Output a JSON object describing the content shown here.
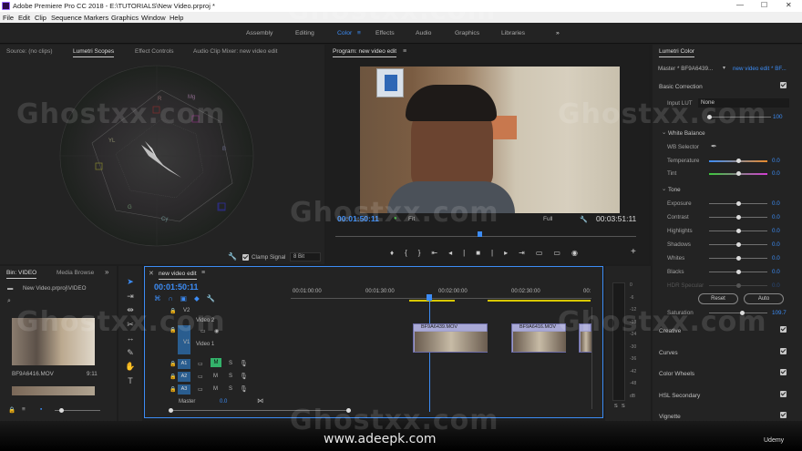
{
  "window": {
    "title": "Adobe Premiere Pro CC 2018 - E:\\TUTORIALS\\New Video.prproj *",
    "min": "—",
    "max": "☐",
    "close": "✕"
  },
  "menu": [
    "File",
    "Edit",
    "Clip",
    "Sequence",
    "Markers",
    "Graphics",
    "Window",
    "Help"
  ],
  "workspaces": [
    "Assembly",
    "Editing",
    "Color",
    "Effects",
    "Audio",
    "Graphics",
    "Libraries"
  ],
  "workspace_active": "Color",
  "workspace_more": "»",
  "source_panel": {
    "tabs": [
      "Source: (no clips)",
      "Lumetri Scopes",
      "Effect Controls",
      "Audio Clip Mixer: new video edit"
    ],
    "active": "Lumetri Scopes",
    "scope_labels": {
      "R": "R",
      "Mg": "Mg",
      "YL": "YL",
      "B": "B",
      "G": "G",
      "Cy": "Cy"
    },
    "clamp_signal": "Clamp Signal",
    "bit_depth": "8 Bit"
  },
  "program": {
    "title": "Program: new video edit",
    "timecode_in": "00:01:50:11",
    "fit": "Fit",
    "quality": "Full",
    "duration": "00:03:51:11"
  },
  "project": {
    "tabs": [
      "Bin: VIDEO",
      "Media Browse"
    ],
    "more": "»",
    "path": "New Video.prproj\\VIDEO",
    "clip_name": "BF9A6416.MOV",
    "clip_duration": "9:11"
  },
  "timeline": {
    "tab": "new video edit",
    "timecode": "00:01:50:11",
    "ruler": [
      "00:01:00:00",
      "00:01:30:00",
      "00:02:00:00",
      "00:02:30:00",
      "00:"
    ],
    "tracks": {
      "v2": "V2",
      "video2": "Video 2",
      "v1": "V1",
      "video1": "Video 1",
      "a1": "A1",
      "a2": "A2",
      "a3": "A3",
      "master": "Master",
      "master_val": "0.0"
    },
    "clips": [
      {
        "label": "BF9A6439.MOV"
      },
      {
        "label": "BF9A6416.MOV"
      }
    ],
    "m": "M",
    "s": "S"
  },
  "meter": {
    "labels": [
      "0",
      "-6",
      "-12",
      "-18",
      "-24",
      "-30",
      "-36",
      "-42",
      "-48",
      "dB"
    ],
    "solo": [
      "S",
      "S"
    ]
  },
  "lumetri": {
    "title": "Lumetri Color",
    "master": "Master * BF9A6439...",
    "sequence": "new video edit * BF...",
    "basic": "Basic Correction",
    "input_lut": "Input LUT",
    "lut_value": "None",
    "lut_val": "100",
    "white_balance": "White Balance",
    "wb_selector": "WB Selector",
    "temperature": {
      "label": "Temperature",
      "value": "0.0"
    },
    "tint": {
      "label": "Tint",
      "value": "0.0"
    },
    "tone": "Tone",
    "tone_rows": [
      {
        "label": "Exposure",
        "value": "0.0"
      },
      {
        "label": "Contrast",
        "value": "0.0"
      },
      {
        "label": "Highlights",
        "value": "0.0"
      },
      {
        "label": "Shadows",
        "value": "0.0"
      },
      {
        "label": "Whites",
        "value": "0.0"
      },
      {
        "label": "Blacks",
        "value": "0.0"
      },
      {
        "label": "HDR Specular",
        "value": "0.0"
      }
    ],
    "reset": "Reset",
    "auto": "Auto",
    "saturation": {
      "label": "Saturation",
      "value": "109.7"
    },
    "sections": [
      "Creative",
      "Curves",
      "Color Wheels",
      "HSL Secondary",
      "Vignette"
    ]
  },
  "watermarks": [
    "Ghostxx.com",
    "Ghostxx.com",
    "Ghostxx.com",
    "Ghostxx.com",
    "Ghostxx.com",
    "Ghostxx.com",
    "Ghostxx.com",
    "Ghostxx.com",
    "Ghostxx.com",
    "Ghostxx.com"
  ],
  "footer": {
    "site": "www.adeepk.com",
    "brand": "Udemy"
  }
}
